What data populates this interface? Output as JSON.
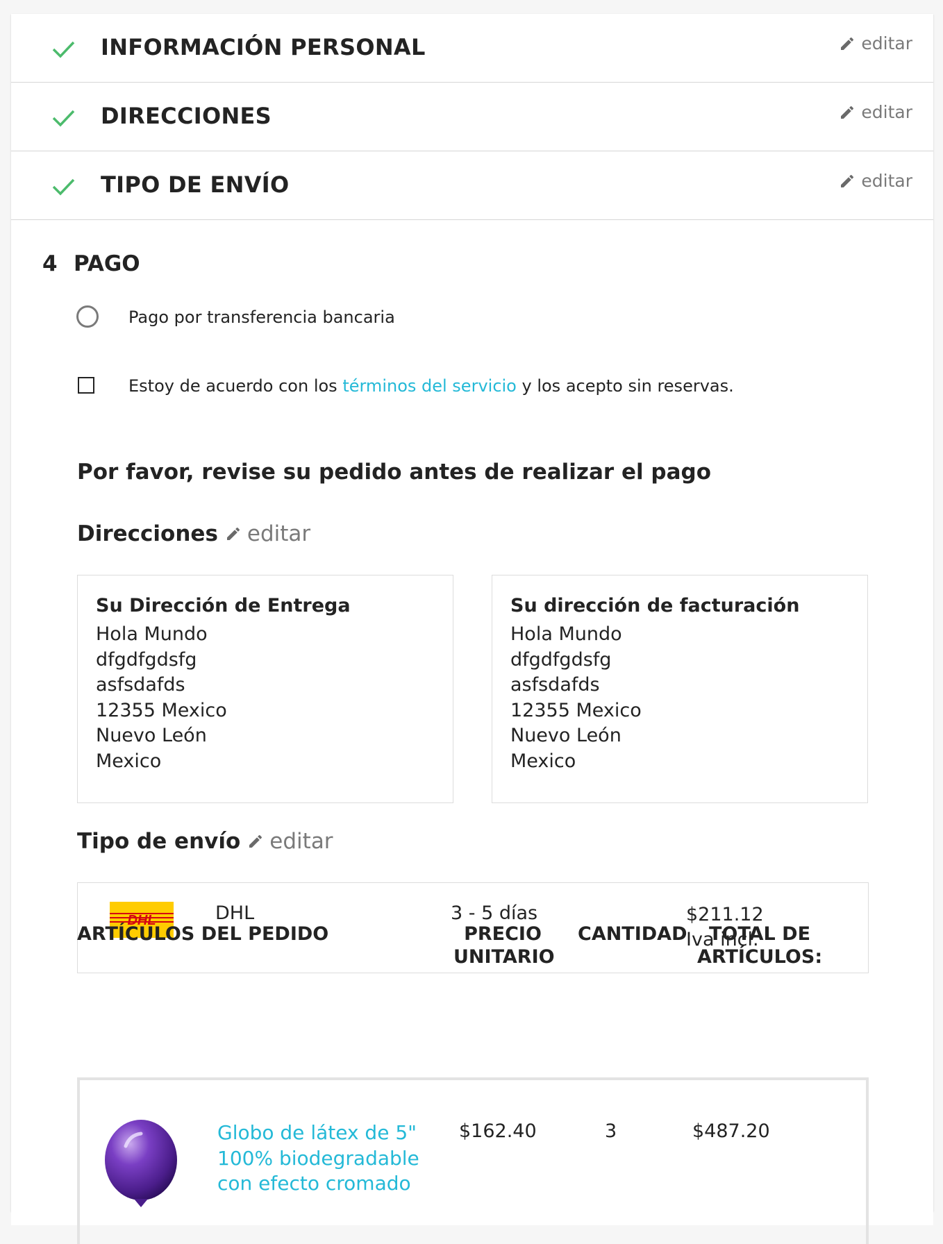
{
  "steps": [
    {
      "title": "INFORMACIÓN PERSONAL",
      "edit_label": "editar"
    },
    {
      "title": "DIRECCIONES",
      "edit_label": "editar"
    },
    {
      "title": "TIPO DE ENVÍO",
      "edit_label": "editar"
    }
  ],
  "payment": {
    "step_number": "4",
    "title": "PAGO",
    "option_label": "Pago por transferencia bancaria",
    "terms_prefix": "Estoy de acuerdo con los",
    "terms_link": "términos del servicio",
    "terms_suffix": "y los acepto sin reservas."
  },
  "review": {
    "title": "Por favor, revise su pedido antes de realizar el pago",
    "addresses_heading": "Direcciones",
    "addresses_edit": "editar",
    "delivery": {
      "title": "Su Dirección de Entrega",
      "lines": [
        "Hola Mundo",
        "dfgdfgdsfg",
        "asfsdafds",
        "12355 Mexico",
        "Nuevo León",
        "Mexico"
      ]
    },
    "billing": {
      "title": "Su dirección de facturación",
      "lines": [
        "Hola Mundo",
        "dfgdfgdsfg",
        "asfsdafds",
        "12355 Mexico",
        "Nuevo León",
        "Mexico"
      ]
    },
    "shipping_heading": "Tipo de envío",
    "shipping_edit": "editar",
    "shipping": {
      "carrier_logo_text": "DHL",
      "carrier": "DHL",
      "delay": "3 - 5 días",
      "price": "$211.12",
      "tax_note": "Iva incl."
    }
  },
  "items_table": {
    "headers": {
      "items": "ARTÍCULOS DEL PEDIDO",
      "unit_price_1": "PRECIO",
      "unit_price_2": "UNITARIO",
      "quantity": "CANTIDAD",
      "total_1": "TOTAL DE",
      "total_2": "ARTÍCULOS:"
    },
    "rows": [
      {
        "name_lines": [
          "Globo de látex de 5\"",
          "100% biodegradable",
          "con efecto cromado"
        ],
        "unit_price": "$162.40",
        "quantity": "3",
        "total": "$487.20"
      }
    ]
  },
  "colors": {
    "accent": "#24b9d7",
    "check": "#4cbb6c",
    "muted": "#7a7a7a",
    "dhl_yellow": "#ffcc00",
    "dhl_red": "#d40511"
  }
}
